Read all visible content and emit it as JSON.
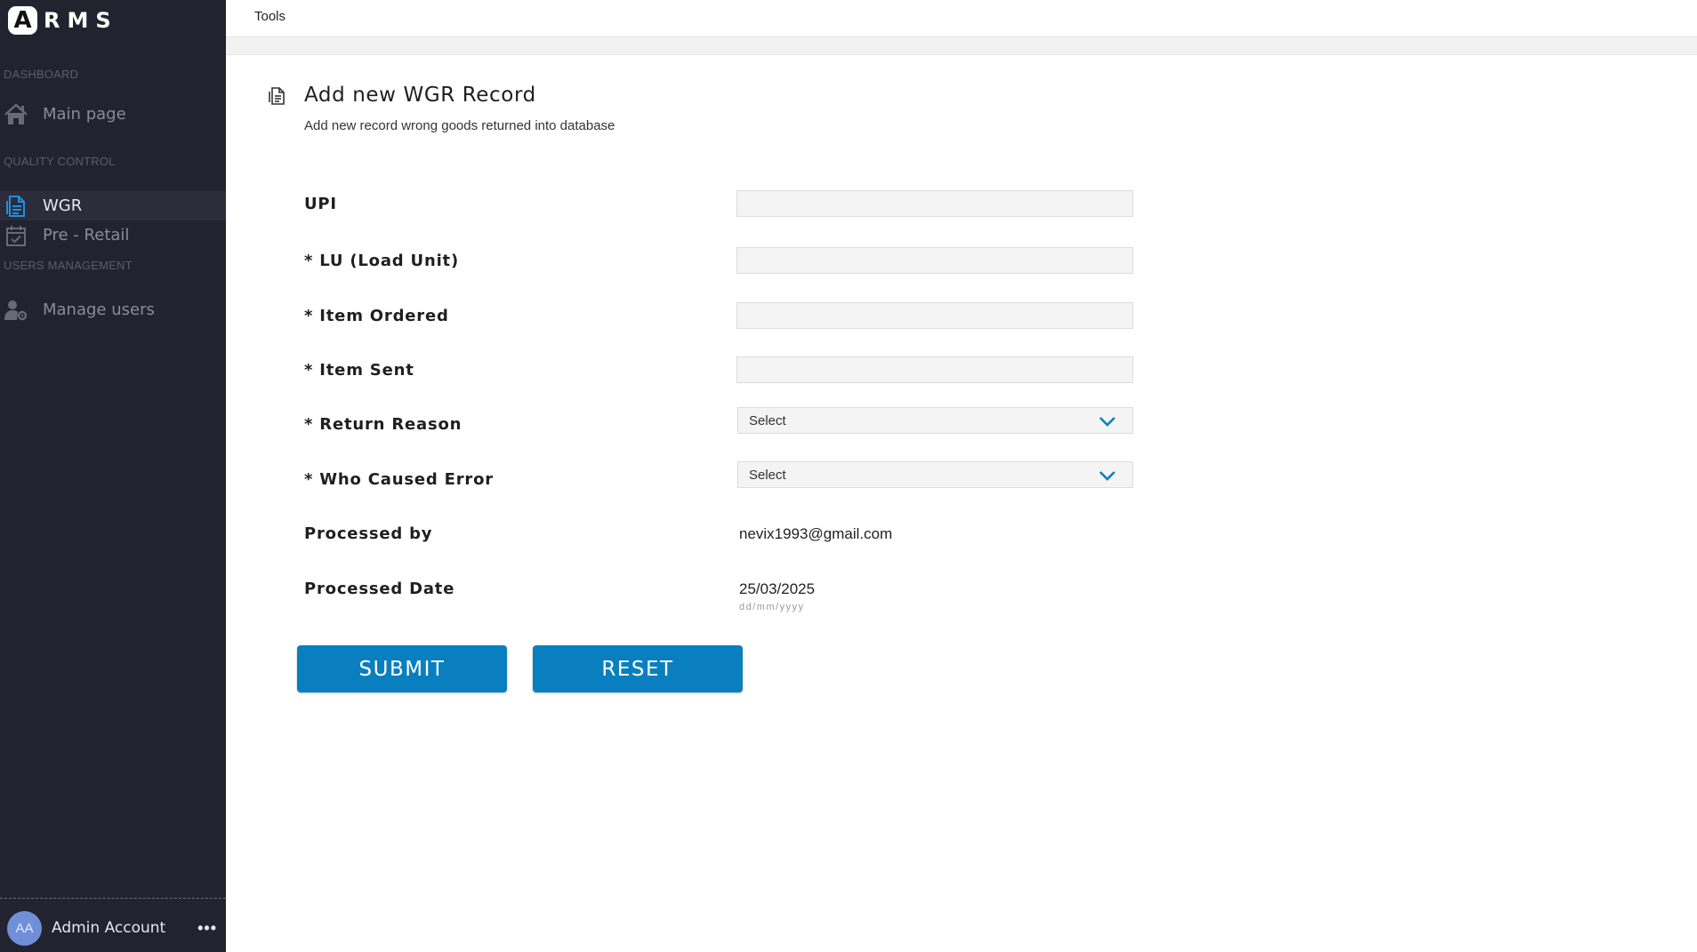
{
  "app": {
    "logo_letter": "A",
    "logo_text": "RMS"
  },
  "sidebar": {
    "sections": [
      {
        "label": "DASHBOARD"
      },
      {
        "label": "QUALITY CONTROL"
      },
      {
        "label": "USERS MANAGEMENT"
      }
    ],
    "items": [
      {
        "label": "Main page",
        "icon": "home-icon",
        "active": false
      },
      {
        "label": "WGR",
        "icon": "document-icon",
        "active": true
      },
      {
        "label": "Pre - Retail",
        "icon": "calendar-check-icon",
        "active": false
      },
      {
        "label": "Manage users",
        "icon": "user-gear-icon",
        "active": false
      }
    ],
    "account": {
      "initials": "AA",
      "name": "Admin Account",
      "more": "•••"
    }
  },
  "topbar": {
    "tools_label": "Tools"
  },
  "header": {
    "title": "Add new WGR Record",
    "subtitle": "Add new record wrong goods returned into database"
  },
  "form": {
    "upi_label": "UPI",
    "upi_value": "",
    "lu_label": "* LU (Load Unit)",
    "lu_value": "",
    "item_ordered_label": "* Item Ordered",
    "item_ordered_value": "",
    "item_sent_label": "* Item Sent",
    "item_sent_value": "",
    "return_reason_label": "* Return Reason",
    "return_reason_value": "Select",
    "who_caused_label": "* Who Caused Error",
    "who_caused_value": "Select",
    "processed_by_label": "Processed by",
    "processed_by_value": "nevix1993@gmail.com",
    "processed_date_label": "Processed Date",
    "processed_date_value": "25/03/2025",
    "processed_date_hint": "dd/mm/yyyy",
    "submit_label": "SUBMIT",
    "reset_label": "RESET"
  },
  "colors": {
    "sidebar_bg": "#23222f",
    "accent": "#0a7fbf",
    "active_icon": "#1e90e0"
  }
}
